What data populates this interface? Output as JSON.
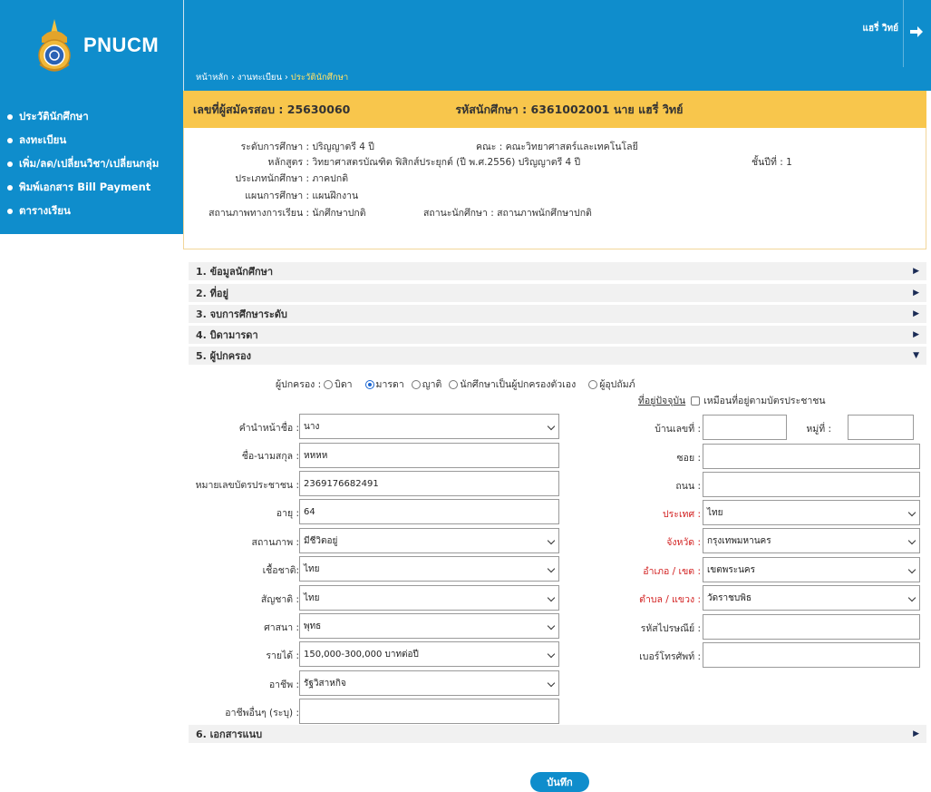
{
  "app": {
    "name": "PNUCM"
  },
  "sidebar": {
    "items": [
      {
        "label": "ประวัตินักศึกษา"
      },
      {
        "label": "ลงทะเบียน"
      },
      {
        "label": "เพิ่ม/ลด/เปลี่ยนวิชา/เปลี่ยนกลุ่ม"
      },
      {
        "label": "พิมพ์เอกสาร Bill Payment"
      },
      {
        "label": "ตารางเรียน"
      }
    ]
  },
  "header": {
    "user_name": "แฮรี่ วิทย์",
    "breadcrumb": [
      "หน้าหลัก",
      "งานทะเบียน",
      "ประวัตินักศึกษา"
    ],
    "breadcrumb_sep": " › "
  },
  "banner": {
    "applicant": "เลขที่ผู้สมัครสอบ : 25630060",
    "student": "รหัสนักศึกษา : 6361002001 นาย แฮรี่ วิทย์"
  },
  "student_info": {
    "level_label": "ระดับการศึกษา :",
    "level_value": "ปริญญาตรี 4 ปี",
    "faculty_label": "คณะ :",
    "faculty_value": "คณะวิทยาศาสตร์และเทคโนโลยี",
    "program_label": "หลักสูตร :",
    "program_value": "วิทยาศาสตรบัณฑิต ฟิสิกส์ประยุกต์ (ปี พ.ศ.2556) ปริญญาตรี 4 ปี",
    "year_label": "ชั้นปีที่ :",
    "year_value": "1",
    "type_label": "ประเภทนักศึกษา :",
    "type_value": "ภาคปกติ",
    "plan_label": "แผนการศึกษา :",
    "plan_value": "แผนฝึกงาน",
    "enroll_status_label": "สถานภาพทางการเรียน :",
    "enroll_status_value": "นักศึกษาปกติ",
    "student_status_label": "สถานะนักศึกษา :",
    "student_status_value": "สถานภาพนักศึกษาปกติ"
  },
  "sections": {
    "s1": "1. ข้อมูลนักศึกษา",
    "s2": "2. ที่อยู่",
    "s3": "3. จบการศึกษาระดับ",
    "s4": "4. บิดามารดา",
    "s5": "5. ผู้ปกครอง",
    "s6": "6. เอกสารแนบ"
  },
  "guardian": {
    "radio_label": "ผู้ปกครอง :",
    "options": [
      "บิดา",
      "มารดา",
      "ญาติ",
      "นักศึกษาเป็นผู้ปกครองตัวเอง",
      "ผู้อุปถัมภ์"
    ],
    "selected": "มารดา",
    "address_link": "ที่อยู่ปัจจุบัน",
    "same_address_label": "เหมือนที่อยู่ตามบัตรประชาชน",
    "same_address_checked": false,
    "fields": {
      "title": {
        "label": "คำนำหน้าชื่อ :",
        "value": "นาง"
      },
      "name": {
        "label": "ชื่อ-นามสกุล :",
        "value": "หหหห"
      },
      "id_card": {
        "label": "หมายเลขบัตรประชาชน :",
        "value": "2369176682491"
      },
      "age": {
        "label": "อายุ :",
        "value": "64"
      },
      "status": {
        "label": "สถานภาพ :",
        "value": "มีชีวิตอยู่"
      },
      "race": {
        "label": "เชื้อชาติ:",
        "value": "ไทย"
      },
      "nationality": {
        "label": "สัญชาติ :",
        "value": "ไทย"
      },
      "religion": {
        "label": "ศาสนา :",
        "value": "พุทธ"
      },
      "income": {
        "label": "รายได้ :",
        "value": "150,000-300,000 บาทต่อปี"
      },
      "occupation": {
        "label": "อาชีพ :",
        "value": "รัฐวิสาหกิจ"
      },
      "other_occupation": {
        "label": "อาชีพอื่นๆ (ระบุ) :",
        "value": ""
      },
      "house_no": {
        "label": "บ้านเลขที่ :",
        "value": ""
      },
      "moo": {
        "label": "หมู่ที่ :",
        "value": ""
      },
      "soi": {
        "label": "ซอย :",
        "value": ""
      },
      "road": {
        "label": "ถนน :",
        "value": ""
      },
      "country": {
        "label": "ประเทศ :",
        "value": "ไทย"
      },
      "province": {
        "label": "จังหวัด :",
        "value": "กรุงเทพมหานคร"
      },
      "district": {
        "label": "อำเภอ / เขต :",
        "value": "เขตพระนคร"
      },
      "subdistrict": {
        "label": "ตำบล / แขวง :",
        "value": "วัดราชบพิธ"
      },
      "postcode": {
        "label": "รหัสไปรษณีย์ :",
        "value": ""
      },
      "phone": {
        "label": "เบอร์โทรศัพท์ :",
        "value": ""
      }
    }
  },
  "actions": {
    "save": "บันทึก"
  },
  "colors": {
    "primary": "#0f8dcc",
    "banner": "#f8c64c",
    "required": "#d21f1f",
    "breadcrumb_current": "#ffe066"
  }
}
